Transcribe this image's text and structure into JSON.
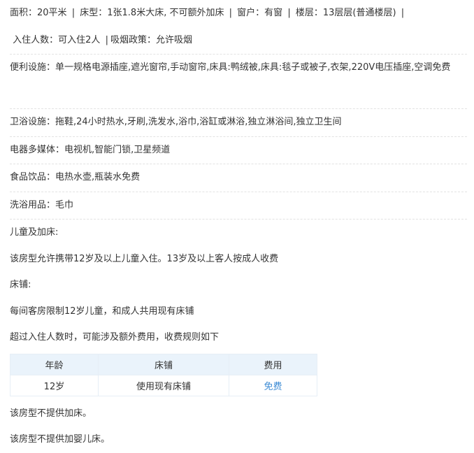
{
  "room": {
    "area_label": "面积：",
    "area_value": "20平米",
    "bed_label": "床型：",
    "bed_value": "1张1.8米大床, 不可额外加床",
    "window_label": "窗户：",
    "window_value": "有窗",
    "floor_label": "楼层：",
    "floor_value": "13层层(普通楼层)",
    "occupancy_label": "入住人数：",
    "occupancy_value": "可入住2人",
    "smoking_label": "吸烟政策：",
    "smoking_value": "允许吸烟",
    "separator": "|"
  },
  "facilities": [
    {
      "label": "便利设施：",
      "value": "单一规格电源插座,遮光窗帘,手动窗帘,床具:鸭绒被,床具:毯子或被子,衣架,220V电压插座,空调免费"
    },
    {
      "label": "卫浴设施：",
      "value": "拖鞋,24小时热水,牙刷,洗发水,浴巾,浴缸或淋浴,独立淋浴间,独立卫生间"
    },
    {
      "label": "电器多媒体：",
      "value": "电视机,智能门锁,卫星频道"
    },
    {
      "label": "食品饮品：",
      "value": "电热水壶,瓶装水免费"
    },
    {
      "label": "洗浴用品：",
      "value": "毛巾"
    }
  ],
  "policy": {
    "children_heading": "儿童及加床:",
    "children_text": "该房型允许携带12岁及以上儿童入住。13岁及以上客人按成人收费",
    "bedding_heading": "床铺:",
    "bedding_text": "每间客房限制12岁儿童，和成人共用现有床铺",
    "extra_fee_text": "超过入住人数时，可能涉及额外费用，收费规则如下",
    "table": {
      "headers": [
        "年龄",
        "床铺",
        "费用"
      ],
      "rows": [
        [
          "12岁",
          "使用现有床铺",
          "免费"
        ]
      ]
    },
    "no_extra_bed": "该房型不提供加床。",
    "no_crib": "该房型不提供加婴儿床。"
  },
  "colors": {
    "text": "#333333",
    "accent": "#3d8bd4",
    "table_header_bg": "#eaf3fb"
  }
}
